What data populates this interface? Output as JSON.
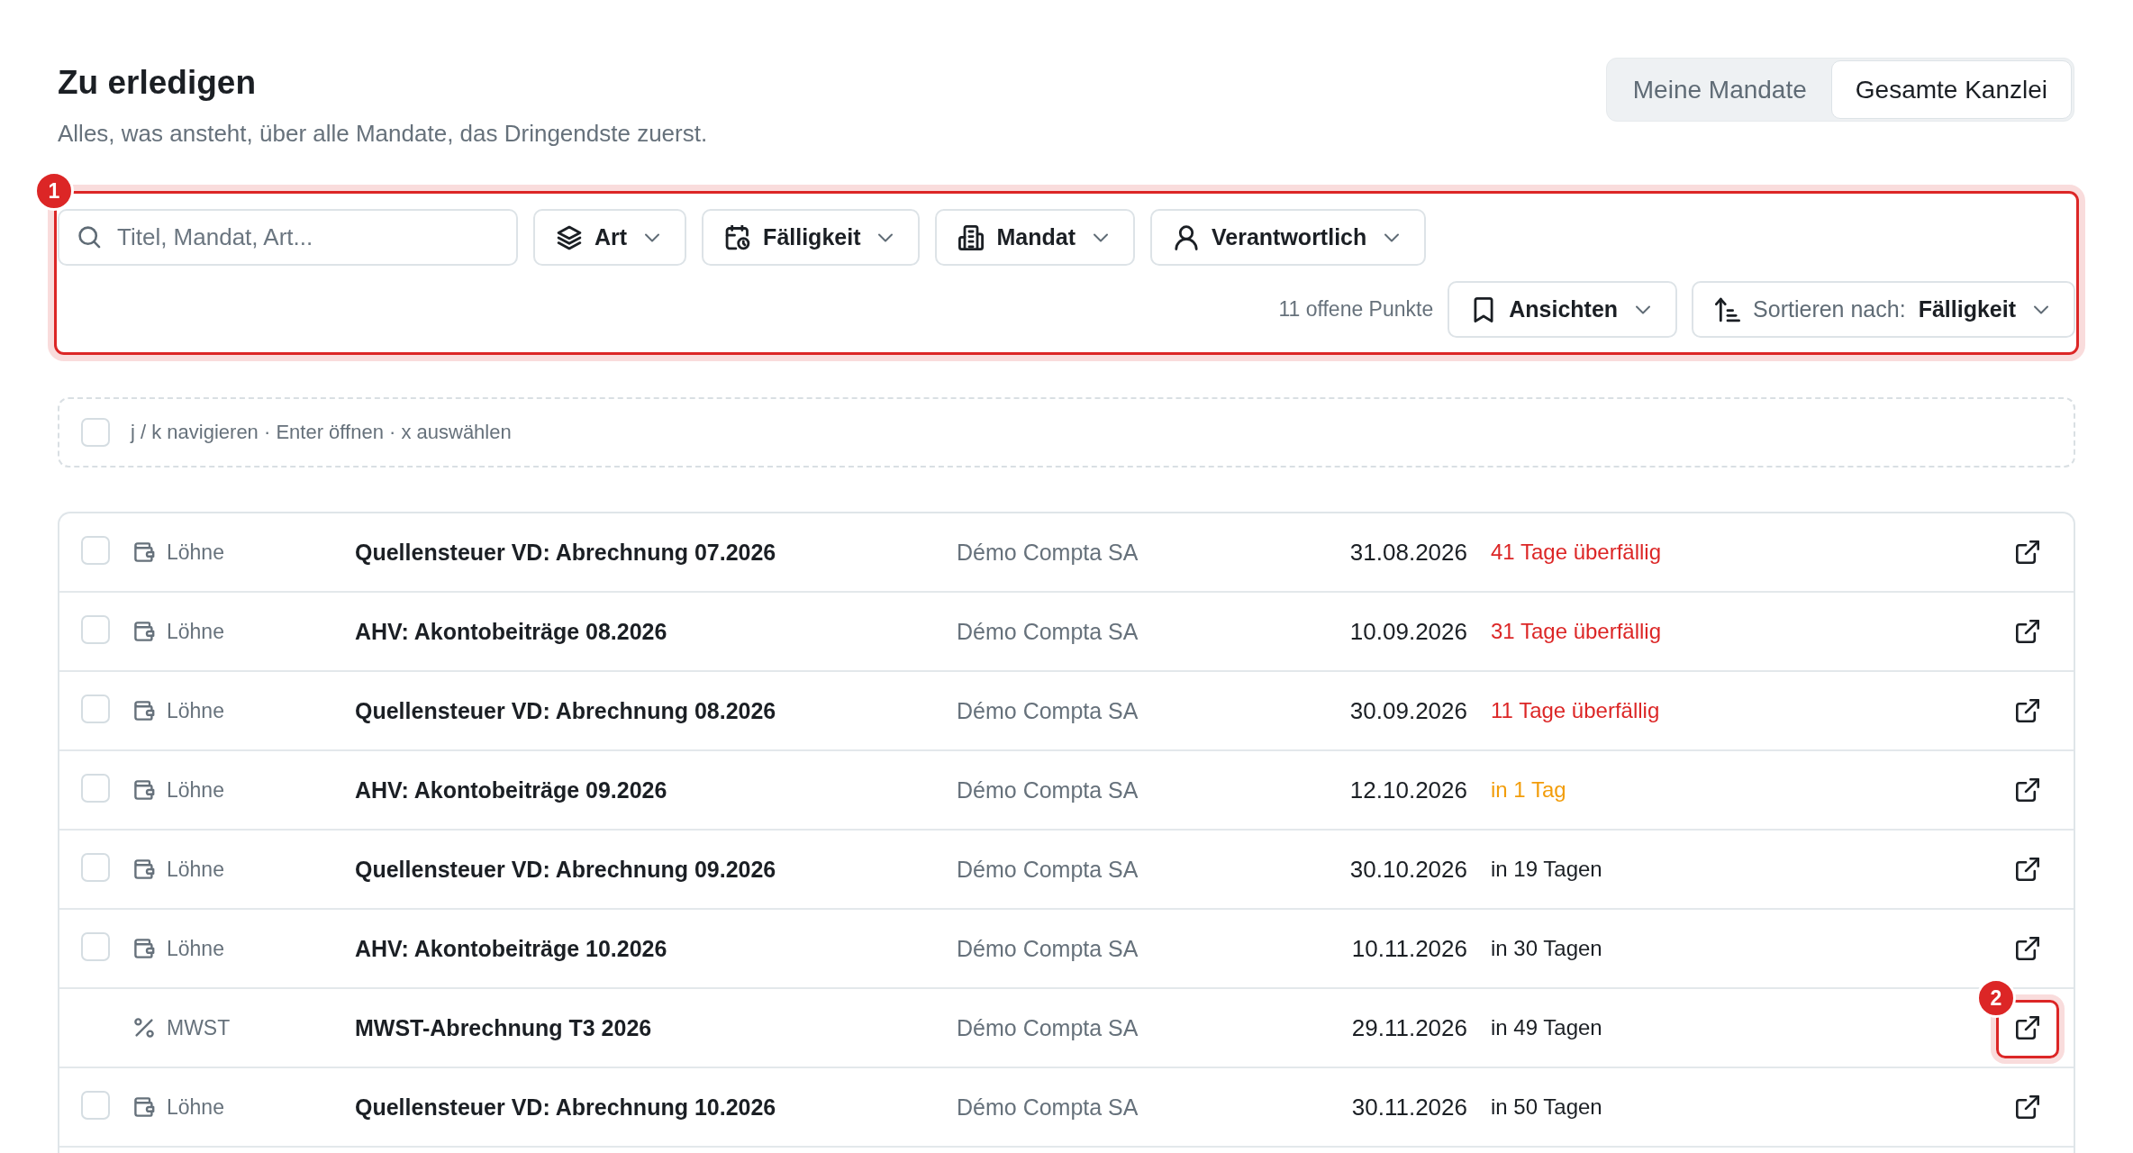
{
  "header": {
    "title": "Zu erledigen",
    "subtitle": "Alles, was ansteht, über alle Mandate, das Dringendste zuerst."
  },
  "scope_toggle": [
    {
      "label": "Meine Mandate",
      "selected": false
    },
    {
      "label": "Gesamte Kanzlei",
      "selected": true
    }
  ],
  "filter_bar": {
    "callout": "1",
    "search": {
      "placeholder": "Titel, Mandat, Art..."
    },
    "filters": [
      {
        "kind": "type",
        "label": "Art"
      },
      {
        "kind": "due",
        "label": "Fälligkeit"
      },
      {
        "kind": "client",
        "label": "Mandat"
      },
      {
        "kind": "owner",
        "label": "Verantwortlich"
      }
    ],
    "count": "11 offene Punkte",
    "views_button": {
      "label": "Ansichten"
    },
    "sort": {
      "prefix": "Sortieren nach:",
      "value": "Fälligkeit"
    }
  },
  "hint_bar": {
    "checkbox": {
      "checked": false
    },
    "text": "j / k navigieren · Enter öffnen · x auswählen"
  },
  "tasks": [
    {
      "checkbox": {
        "checked": false
      },
      "category": {
        "kind": "payroll",
        "label": "Löhne"
      },
      "title": "Quellensteuer VD: Abrechnung 07.2026",
      "client": "Démo Compta SA",
      "due_date": "31.08.2026",
      "due_relative": "41 Tage überfällig",
      "color": "#dc2626"
    },
    {
      "checkbox": {
        "checked": false
      },
      "category": {
        "kind": "payroll",
        "label": "Löhne"
      },
      "title": "AHV: Akontobeiträge 08.2026",
      "client": "Démo Compta SA",
      "due_date": "10.09.2026",
      "due_relative": "31 Tage überfällig",
      "color": "#dc2626"
    },
    {
      "checkbox": {
        "checked": false
      },
      "category": {
        "kind": "payroll",
        "label": "Löhne"
      },
      "title": "Quellensteuer VD: Abrechnung 08.2026",
      "client": "Démo Compta SA",
      "due_date": "30.09.2026",
      "due_relative": "11 Tage überfällig",
      "color": "#dc2626"
    },
    {
      "checkbox": {
        "checked": false
      },
      "category": {
        "kind": "payroll",
        "label": "Löhne"
      },
      "title": "AHV: Akontobeiträge 09.2026",
      "client": "Démo Compta SA",
      "due_date": "12.10.2026",
      "due_relative": "in 1 Tag",
      "color": "#f29d0b"
    },
    {
      "checkbox": {
        "checked": false
      },
      "category": {
        "kind": "payroll",
        "label": "Löhne"
      },
      "title": "Quellensteuer VD: Abrechnung 09.2026",
      "client": "Démo Compta SA",
      "due_date": "30.10.2026",
      "due_relative": "in 19 Tagen",
      "color": "#1b1f24"
    },
    {
      "checkbox": {
        "checked": false
      },
      "category": {
        "kind": "payroll",
        "label": "Löhne"
      },
      "title": "AHV: Akontobeiträge 10.2026",
      "client": "Démo Compta SA",
      "due_date": "10.11.2026",
      "due_relative": "in 30 Tagen",
      "color": "#1b1f24"
    },
    {
      "category": {
        "kind": "vat",
        "label": "MWST"
      },
      "title": "MWST-Abrechnung T3 2026",
      "client": "Démo Compta SA",
      "due_date": "29.11.2026",
      "due_relative": "in 49 Tagen",
      "color": "#1b1f24",
      "callout": "2"
    },
    {
      "checkbox": {
        "checked": false
      },
      "category": {
        "kind": "payroll",
        "label": "Löhne"
      },
      "title": "Quellensteuer VD: Abrechnung 10.2026",
      "client": "Démo Compta SA",
      "due_date": "30.11.2026",
      "due_relative": "in 50 Tagen",
      "color": "#1b1f24"
    }
  ]
}
